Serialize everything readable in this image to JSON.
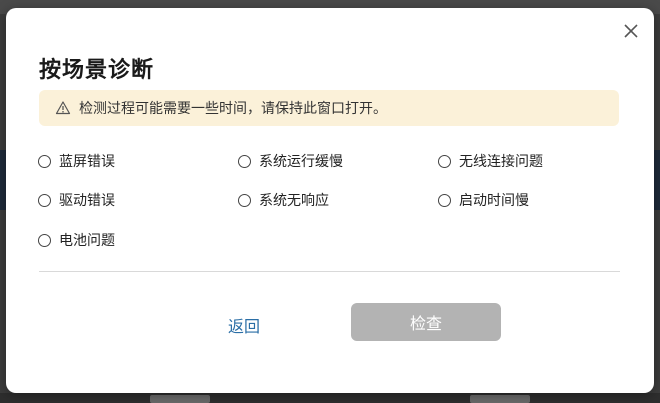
{
  "dialog": {
    "title": "按场景诊断",
    "notice": {
      "icon": "warning-icon",
      "text": "检测过程可能需要一些时间，请保持此窗口打开。",
      "background": "#fbf1d9"
    },
    "options": [
      {
        "label": "蓝屏错误",
        "selected": false
      },
      {
        "label": "系统运行缓慢",
        "selected": false
      },
      {
        "label": "无线连接问题",
        "selected": false
      },
      {
        "label": "驱动错误",
        "selected": false
      },
      {
        "label": "系统无响应",
        "selected": false
      },
      {
        "label": "启动时间慢",
        "selected": false
      },
      {
        "label": "电池问题",
        "selected": false
      }
    ],
    "back_label": "返回",
    "check_label": "检查",
    "check_enabled": false
  },
  "colors": {
    "link": "#2a6ea6",
    "button_disabled": "#b3b3b3"
  }
}
